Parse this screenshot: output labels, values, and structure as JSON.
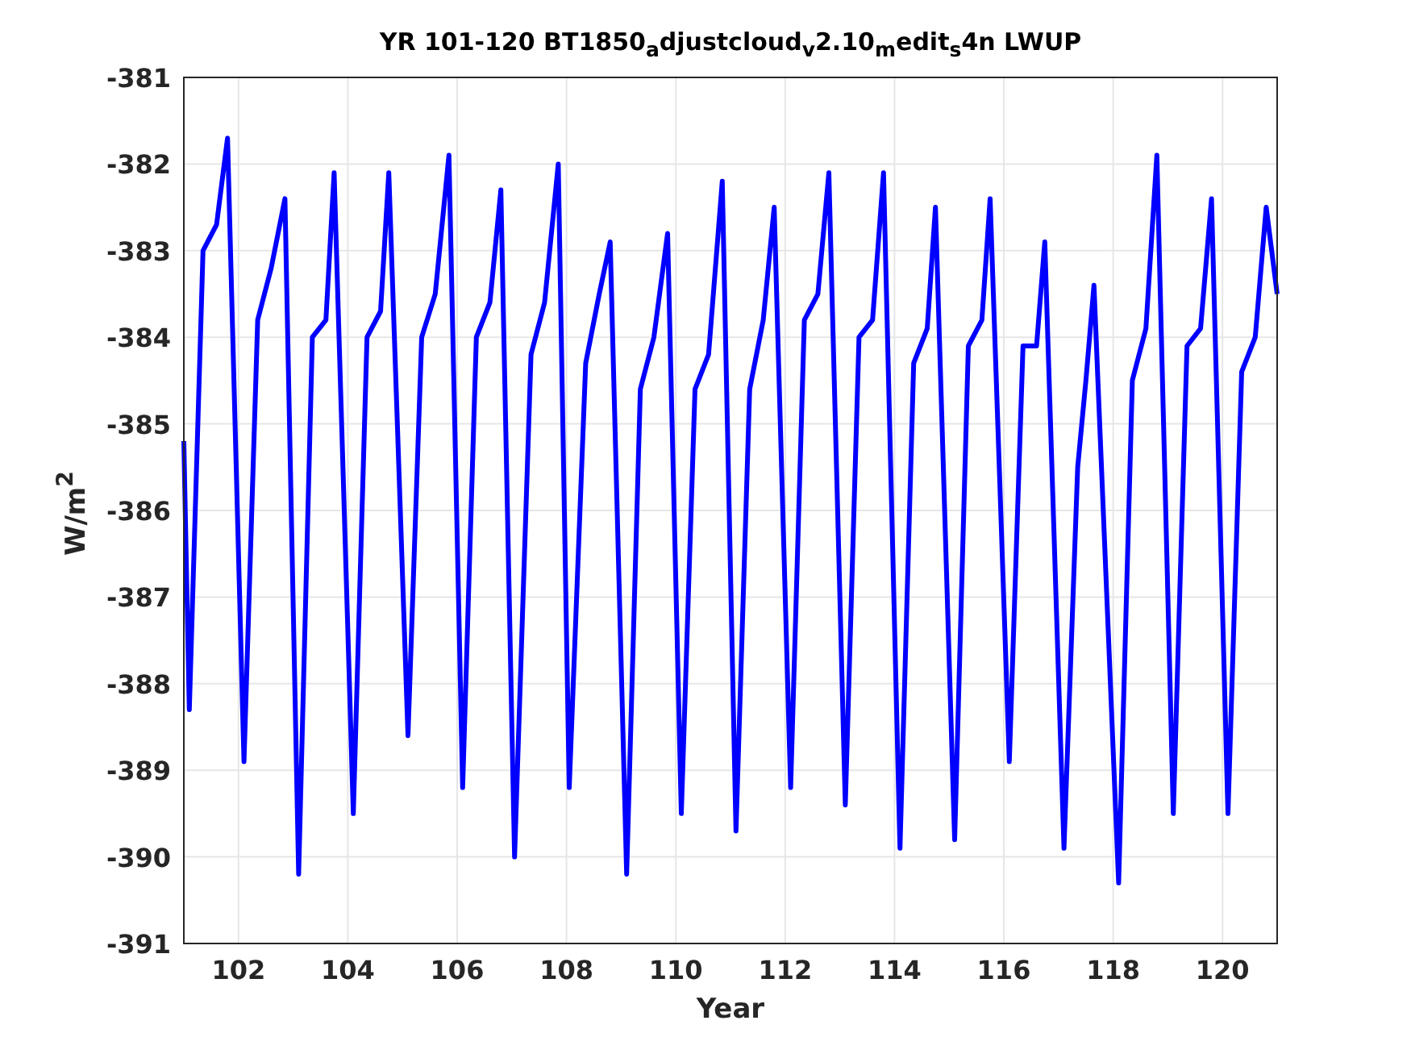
{
  "figure": {
    "chart_data": {
      "type": "line",
      "title": "YR 101-120 BT1850$_{a}$djustcloud$_{v}$2.10$_{m}$edit$_{s}$4n LWUP",
      "xlabel": "Year",
      "ylabel": "W/m$^{2}$",
      "grid": true,
      "xlim": [
        101,
        121
      ],
      "ylim": [
        -391,
        -381
      ],
      "xticks": [
        102,
        104,
        106,
        108,
        110,
        112,
        114,
        116,
        118,
        120
      ],
      "yticks": [
        -391,
        -390,
        -389,
        -388,
        -387,
        -386,
        -385,
        -384,
        -383,
        -382,
        -381
      ],
      "x": [
        101.0,
        101.1,
        101.35,
        101.6,
        101.8,
        102.1,
        102.35,
        102.6,
        102.85,
        103.1,
        103.35,
        103.6,
        103.75,
        104.1,
        104.35,
        104.6,
        104.75,
        105.1,
        105.35,
        105.6,
        105.85,
        106.1,
        106.35,
        106.6,
        106.8,
        107.05,
        107.35,
        107.6,
        107.85,
        108.05,
        108.35,
        108.6,
        108.8,
        109.1,
        109.35,
        109.6,
        109.85,
        110.1,
        110.35,
        110.6,
        110.85,
        111.1,
        111.35,
        111.6,
        111.8,
        112.1,
        112.35,
        112.6,
        112.8,
        113.1,
        113.35,
        113.6,
        113.8,
        114.1,
        114.35,
        114.6,
        114.75,
        115.1,
        115.35,
        115.6,
        115.75,
        116.1,
        116.35,
        116.6,
        116.75,
        117.1,
        117.35,
        117.5,
        117.65,
        118.1,
        118.35,
        118.6,
        118.8,
        119.1,
        119.35,
        119.6,
        119.8,
        120.1,
        120.35,
        120.6,
        120.8,
        121.0
      ],
      "series": [
        {
          "color": "#0000ff",
          "values": [
            -385.2,
            -388.3,
            -383.0,
            -382.7,
            -381.7,
            -388.9,
            -383.8,
            -383.2,
            -382.4,
            -390.2,
            -384.0,
            -383.8,
            -382.1,
            -389.5,
            -384.0,
            -383.7,
            -382.1,
            -388.6,
            -384.0,
            -383.5,
            -381.9,
            -389.2,
            -384.0,
            -383.6,
            -382.3,
            -390.0,
            -384.2,
            -383.6,
            -382.0,
            -389.2,
            -384.3,
            -383.5,
            -382.9,
            -390.2,
            -384.6,
            -384.0,
            -382.8,
            -389.5,
            -384.6,
            -384.2,
            -382.2,
            -389.7,
            -384.6,
            -383.8,
            -382.5,
            -389.2,
            -383.8,
            -383.5,
            -382.1,
            -389.4,
            -384.0,
            -383.8,
            -382.1,
            -389.9,
            -384.3,
            -383.9,
            -382.5,
            -389.8,
            -384.1,
            -383.8,
            -382.4,
            -388.9,
            -384.1,
            -384.1,
            -382.9,
            -389.9,
            -385.5,
            -384.5,
            -383.4,
            -390.3,
            -384.5,
            -383.9,
            -381.9,
            -389.5,
            -384.1,
            -383.9,
            -382.4,
            -389.5,
            -384.4,
            -384.0,
            -382.5,
            -383.5
          ]
        }
      ]
    }
  }
}
